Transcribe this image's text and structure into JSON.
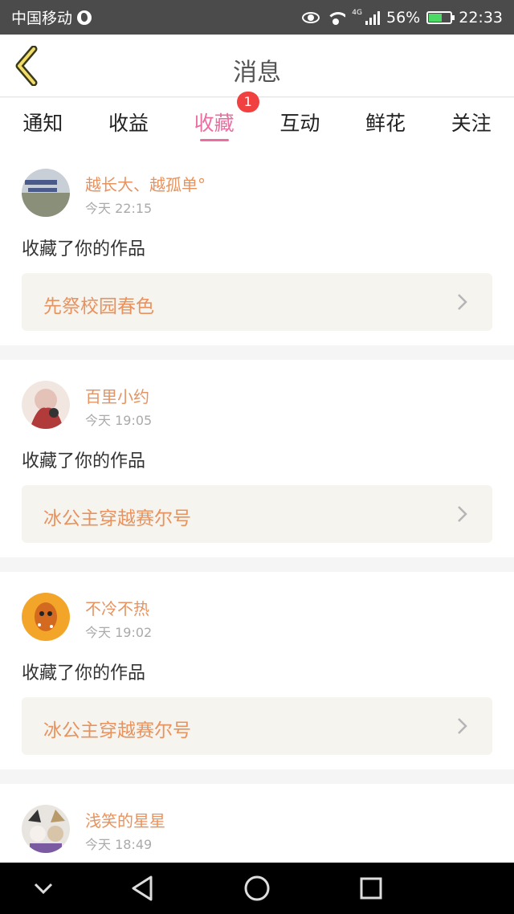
{
  "status": {
    "carrier": "中国移动",
    "network": "4G",
    "battery": "56%",
    "time": "22:33"
  },
  "header": {
    "title": "消息"
  },
  "tabs": [
    {
      "label": "通知",
      "active": false
    },
    {
      "label": "收益",
      "active": false
    },
    {
      "label": "收藏",
      "active": true,
      "badge": "1"
    },
    {
      "label": "互动",
      "active": false
    },
    {
      "label": "鲜花",
      "active": false
    },
    {
      "label": "关注",
      "active": false
    }
  ],
  "items": [
    {
      "user": "越长大、越孤单°",
      "time": "今天 22:15",
      "action": "收藏了你的作品",
      "work": "先祭校园春色"
    },
    {
      "user": "百里小约",
      "time": "今天 19:05",
      "action": "收藏了你的作品",
      "work": "冰公主穿越赛尔号"
    },
    {
      "user": "不冷不热",
      "time": "今天 19:02",
      "action": "收藏了你的作品",
      "work": "冰公主穿越赛尔号"
    },
    {
      "user": "浅笑的星星",
      "time": "今天 18:49"
    }
  ],
  "colors": {
    "accent": "#ea6fa0",
    "username": "#e8935f",
    "badge": "#f04040",
    "work_bg": "#f6f4ee"
  }
}
